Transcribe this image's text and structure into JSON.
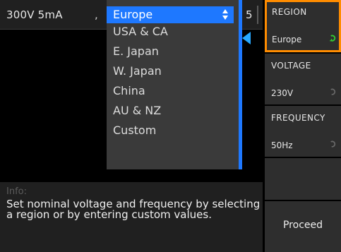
{
  "status": {
    "left": "300V 5mA",
    "sep": ",",
    "right": "5"
  },
  "dropdown": {
    "selected": "Europe",
    "items": [
      "USA & CA",
      "E. Japan",
      "W. Japan",
      "China",
      "AU & NZ",
      "Custom"
    ]
  },
  "info": {
    "label": "Info:",
    "text": "Set nominal voltage and frequency by selecting a region or by entering custom values."
  },
  "softkeys": {
    "region": {
      "title": "REGION",
      "value": "Europe"
    },
    "voltage": {
      "title": "VOLTAGE",
      "value": "230V"
    },
    "frequency": {
      "title": "FREQUENCY",
      "value": "50Hz"
    },
    "proceed": {
      "label": "Proceed"
    }
  },
  "colors": {
    "accent": "#1e78ff",
    "highlight": "#ff8c00",
    "knob_active": "#33cc33",
    "knob_inactive": "#6a6a6a"
  }
}
